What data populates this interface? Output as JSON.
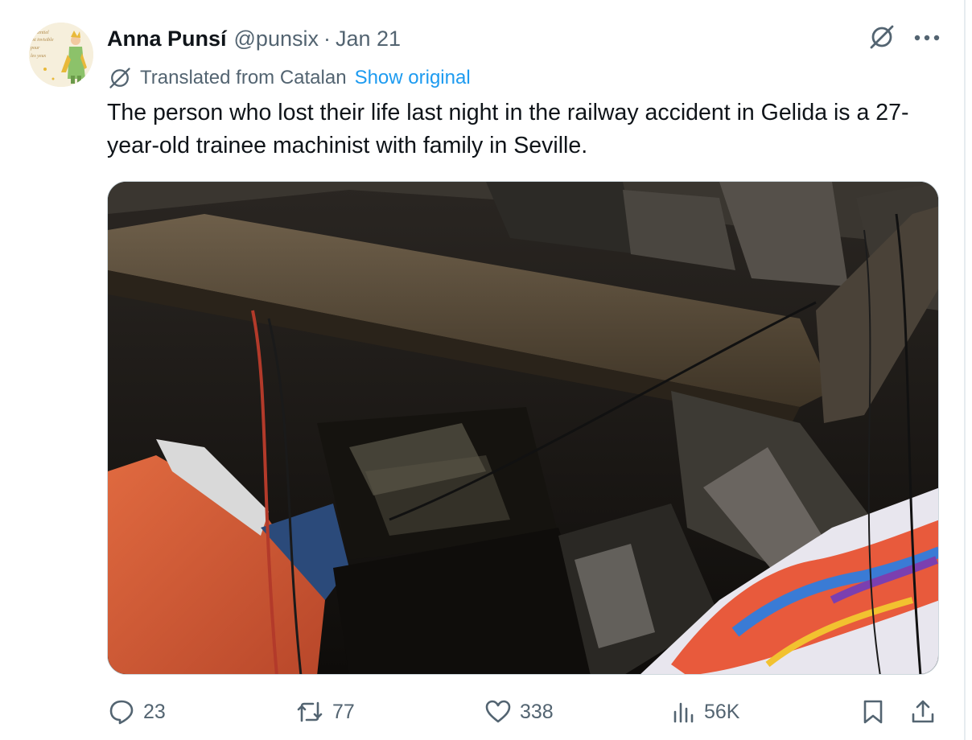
{
  "author": {
    "name": "Anna Punsí",
    "handle": "@punsix",
    "separator": "·",
    "date": "Jan 21",
    "avatar_text": [
      "essentiel",
      "est invisible",
      "pour",
      "les yeux"
    ]
  },
  "translation": {
    "label": "Translated from Catalan",
    "link": "Show original"
  },
  "tweet": {
    "text": "The person who lost their life last night in the railway accident in Gelida is a 27-year-old trainee machinist with family in Seville."
  },
  "media": {
    "icon": "photo-wreckage"
  },
  "actions": {
    "replies": "23",
    "reposts": "77",
    "likes": "338",
    "views": "56K"
  },
  "icons": {
    "grok": "grok-icon",
    "more": "more-icon",
    "translate": "translate-icon",
    "reply": "reply-icon",
    "repost": "repost-icon",
    "like": "heart-icon",
    "views": "views-icon",
    "bookmark": "bookmark-icon",
    "share": "share-icon"
  },
  "colors": {
    "text": "#0f1419",
    "secondary": "#536471",
    "link": "#1d9bf0",
    "border": "#cfd9de"
  }
}
